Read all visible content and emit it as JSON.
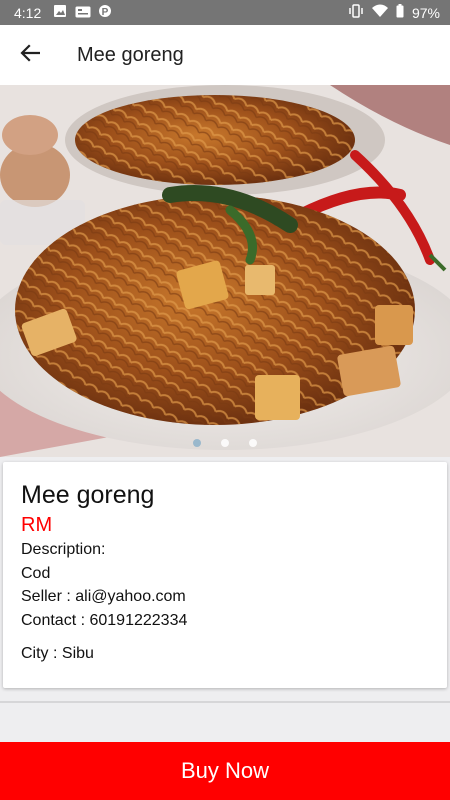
{
  "status": {
    "time": "4:12",
    "battery": "97%",
    "left_icons": [
      "image-icon",
      "card-icon",
      "p-icon"
    ],
    "right_icons": [
      "vibrate-icon",
      "wifi-icon",
      "battery-icon"
    ]
  },
  "appbar": {
    "back_icon": "arrow-back-icon",
    "title": "Mee goreng"
  },
  "carousel": {
    "total": 3,
    "active_index": 0
  },
  "product": {
    "title": "Mee goreng",
    "price": "RM",
    "description_label": "Description:",
    "description": "Cod",
    "seller": "Seller : ali@yahoo.com",
    "contact": "Contact : 60191222334",
    "city": "City : Sibu"
  },
  "action": {
    "buy_label": "Buy Now"
  },
  "colors": {
    "accent": "#ff0000",
    "statusbar": "#757575"
  }
}
